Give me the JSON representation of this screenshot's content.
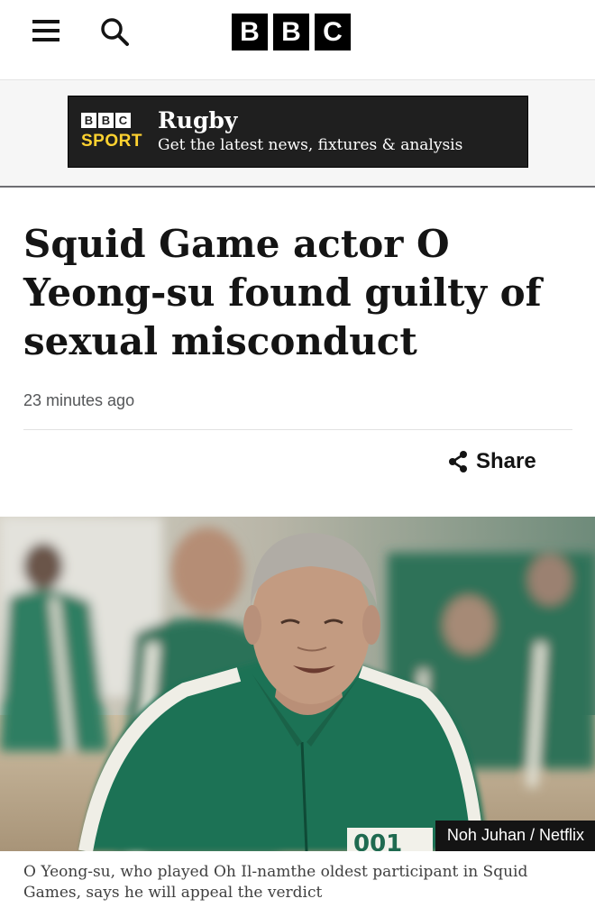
{
  "header": {
    "menu_icon": "hamburger-menu-icon",
    "search_icon": "search-icon",
    "logo_letters": [
      "B",
      "B",
      "C"
    ]
  },
  "banner": {
    "logo_letters": [
      "B",
      "B",
      "C"
    ],
    "logo_sport": "SPORT",
    "title": "Rugby",
    "subtitle": "Get the latest news, fixtures & analysis",
    "accent_color": "#ffd230"
  },
  "article": {
    "headline": "Squid Game actor O Yeong-su found guilty of sexual misconduct",
    "timestamp": "23 minutes ago",
    "share_label": "Share",
    "share_icon": "share-icon",
    "image_credit": "Noh Juhan / Netflix",
    "caption": "O Yeong-su, who played Oh Il-namthe oldest participant in Squid Games, says he will appeal the verdict"
  }
}
